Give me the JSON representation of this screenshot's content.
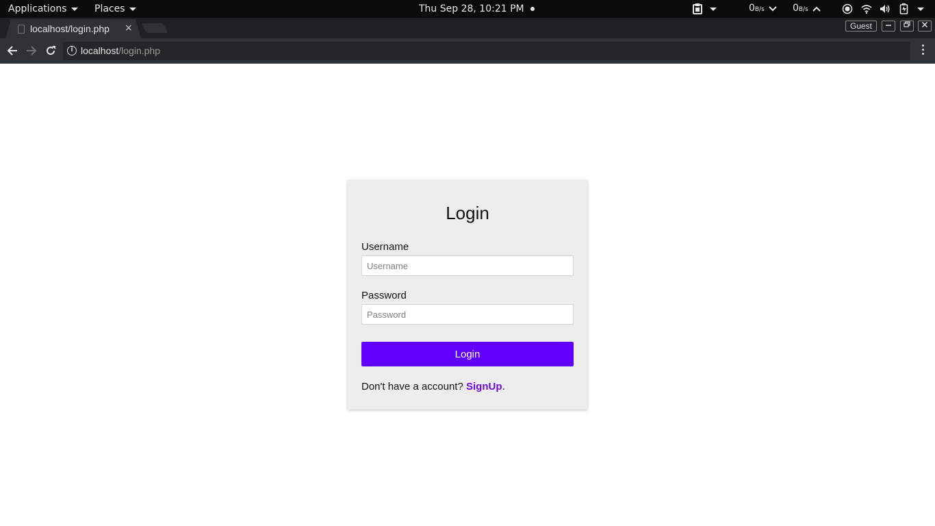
{
  "topbar": {
    "applications": "Applications",
    "places": "Places",
    "clock": "Thu Sep 28, 10:21 PM",
    "net_down_value": "0",
    "net_down_unit": "B/s",
    "net_up_value": "0",
    "net_up_unit": "B/s"
  },
  "browser": {
    "tab_title": "localhost/login.php",
    "tab_close": "×",
    "profile": "Guest",
    "url_host": "localhost",
    "url_path": "/login.php"
  },
  "login": {
    "title": "Login",
    "username_label": "Username",
    "username_placeholder": "Username",
    "password_label": "Password",
    "password_placeholder": "Password",
    "button_label": "Login",
    "signup_prompt": "Don't have a account?",
    "signup_link": "SignUp",
    "signup_suffix": "."
  },
  "colors": {
    "accent": "#6200ff",
    "link": "#6a0dd6",
    "card_bg": "#ededed",
    "topbar_bg": "#0b0b0b"
  },
  "icons": [
    "caret-down-icon",
    "clipboard-icon",
    "chevron-down-icon",
    "chevron-up-icon",
    "record-icon",
    "wifi-icon",
    "volume-icon",
    "battery-icon",
    "back-arrow-icon",
    "forward-arrow-icon",
    "reload-icon",
    "info-icon",
    "kebab-menu-icon"
  ]
}
